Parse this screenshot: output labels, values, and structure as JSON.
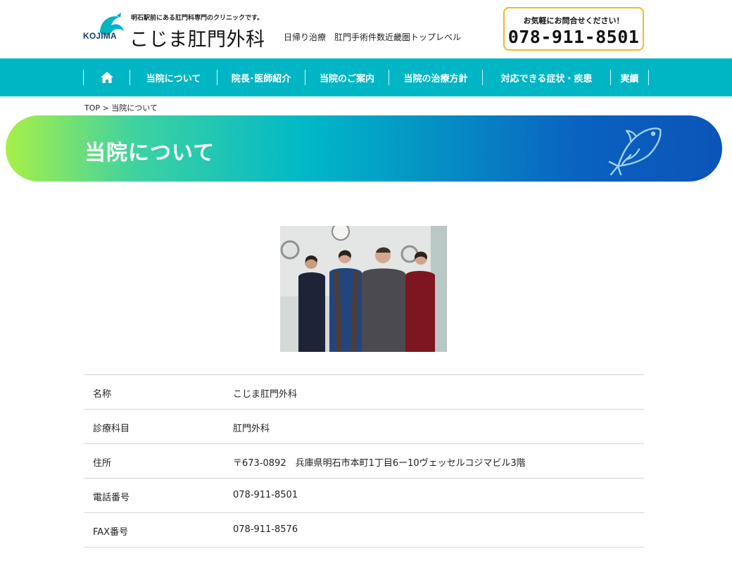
{
  "header": {
    "logo_en": "KOJIMA",
    "tagline_small": "明石駅前にある肛門科専門のクリニックです。",
    "clinic_name": "こじま肛門外科",
    "tagline": "日帰り治療　肛門手術件数近畿圏トップレベル",
    "tel_label": "お気軽にお問合せください！",
    "tel_number": "078-911-8501"
  },
  "nav": {
    "home_icon": "home-icon",
    "items": [
      {
        "label": "当院について"
      },
      {
        "label": "院長･医師紹介"
      },
      {
        "label": "当院のご案内"
      },
      {
        "label": "当院の治療方針"
      },
      {
        "label": "対応できる症状・疾患"
      },
      {
        "label": "実績"
      }
    ]
  },
  "breadcrumb": {
    "top": "TOP",
    "separator": " > ",
    "current": "当院について"
  },
  "banner": {
    "title": "当院について",
    "icon": "fish-icon"
  },
  "info": {
    "rows": [
      {
        "label": "名称",
        "value": "こじま肛門外科"
      },
      {
        "label": "診療科目",
        "value": "肛門外科"
      },
      {
        "label": "住所",
        "value": "〒673-0892　兵庫県明石市本町1丁目6ー10ヴェッセルコジマビル3階"
      },
      {
        "label": "電話番号",
        "value": "078-911-8501"
      },
      {
        "label": "FAX番号",
        "value": "078-911-8576"
      }
    ]
  },
  "colors": {
    "nav_bg": "#00b6c5",
    "tel_border": "#f5b820",
    "gradient_start": "#a8f048",
    "gradient_end": "#0b54b8"
  }
}
